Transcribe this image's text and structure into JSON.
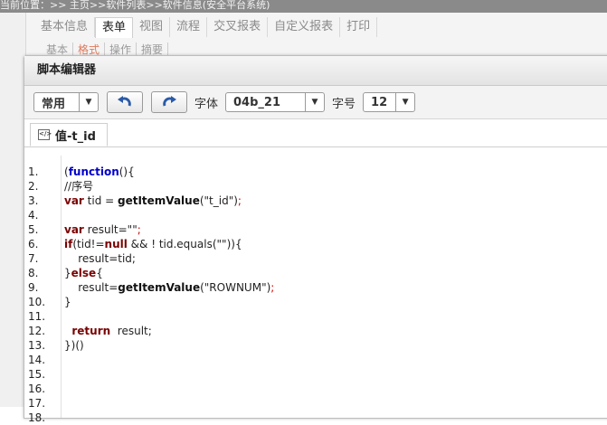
{
  "breadcrumb": "当前位置：>> 主页>>软件列表>>软件信息(安全平台系统)",
  "main_tabs": [
    {
      "label": "基本信息",
      "active": false
    },
    {
      "label": "表单",
      "active": true
    },
    {
      "label": "视图",
      "active": false
    },
    {
      "label": "流程",
      "active": false
    },
    {
      "label": "交叉报表",
      "active": false
    },
    {
      "label": "自定义报表",
      "active": false
    },
    {
      "label": "打印",
      "active": false
    }
  ],
  "sub_tabs": [
    {
      "label": "基本",
      "active": false
    },
    {
      "label": "格式",
      "active": true
    },
    {
      "label": "操作",
      "active": false
    },
    {
      "label": "摘要",
      "active": false
    }
  ],
  "dialog": {
    "title": "脚本编辑器",
    "toolbar": {
      "mode_value": "常用",
      "undo_icon": "undo-icon",
      "redo_icon": "redo-icon",
      "font_label": "字体",
      "font_value": "04b_21",
      "size_label": "字号",
      "size_value": "12"
    },
    "editor_tab": "值-t_id",
    "line_numbers": [
      "1.",
      "2.",
      "3.",
      "4.",
      "5.",
      "6.",
      "7.",
      "8.",
      "9.",
      "10.",
      "11.",
      "12.",
      "13.",
      "14.",
      "15.",
      "16.",
      "17.",
      "18."
    ],
    "code": {
      "l1_open": "(",
      "l1_kw": "function",
      "l1_rest": "(){",
      "l2": "//序号",
      "l3_kw": "var",
      "l3_mid": " tid = ",
      "l3_fn": "getItemValue",
      "l3_arg": "(\"t_id\")",
      "l3_end": ";",
      "l5_kw": "var",
      "l5_mid": " result=",
      "l5_str": "\"\"",
      "l5_end": ";",
      "l6_kw": "if",
      "l6_a": "(tid!=",
      "l6_null": "null",
      "l6_b": " && ! tid.equals(",
      "l6_str": "\"\"",
      "l6_c": ")){",
      "l7": "    result=tid;",
      "l8_a": "}",
      "l8_kw": "else",
      "l8_b": "{",
      "l9_a": "    result=",
      "l9_fn": "getItemValue",
      "l9_arg": "(\"ROWNUM\")",
      "l9_end": ";",
      "l10": "}",
      "l12_kw": "  return",
      "l12_rest": "  result;",
      "l13": "})()"
    }
  }
}
